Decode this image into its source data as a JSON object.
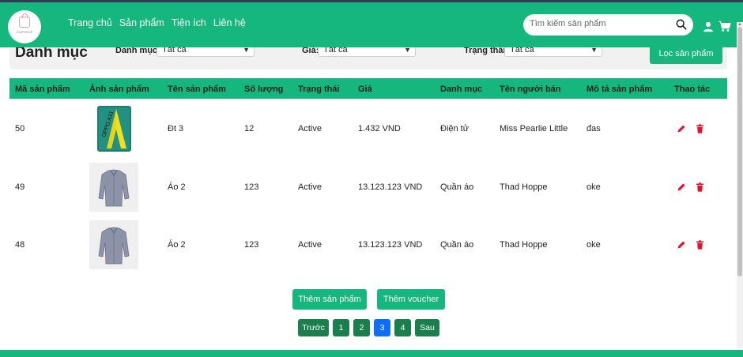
{
  "brand": {
    "logo_text": "CHIPSHOP"
  },
  "nav": {
    "links": [
      "Trang chủ",
      "Sản phẩm",
      "Tiện ích",
      "Liên hệ"
    ]
  },
  "search": {
    "placeholder": "Tìm kiếm sản phẩm",
    "value": ""
  },
  "filters": {
    "title": "Danh mục",
    "category_label": "Danh mục:",
    "category_value": "Tất cả",
    "price_label": "Giá:",
    "price_value": "Tất cả",
    "status_label": "Trạng thái:",
    "status_value": "Tất cả",
    "filter_button": "Lọc sản phẩm"
  },
  "table": {
    "headers": [
      "Mã sản phẩm",
      "Ảnh sản phẩm",
      "Tên sản phẩm",
      "Số lượng",
      "Trạng thái",
      "Giá",
      "Danh mục",
      "Tên người bán",
      "Mô tả sản phẩm",
      "Thao tác"
    ],
    "rows": [
      {
        "id": "50",
        "image": "phone",
        "name": "Đt 3",
        "quantity": "12",
        "status": "Active",
        "price": "1.432 VND",
        "category": "Điện tử",
        "seller": "Miss Pearlie Little",
        "description": "đas"
      },
      {
        "id": "49",
        "image": "shirt",
        "name": "Áo 2",
        "quantity": "123",
        "status": "Active",
        "price": "13.123.123 VND",
        "category": "Quần áo",
        "seller": "Thad Hoppe",
        "description": "oke"
      },
      {
        "id": "48",
        "image": "shirt",
        "name": "Áo 2",
        "quantity": "123",
        "status": "Active",
        "price": "13.123.123 VND",
        "category": "Quần áo",
        "seller": "Thad Hoppe",
        "description": "oke"
      }
    ]
  },
  "actions": {
    "add_product": "Thêm sản phẩm",
    "add_voucher": "Thêm voucher"
  },
  "pagination": {
    "prev": "Trước",
    "pages": [
      "1",
      "2",
      "3",
      "4"
    ],
    "current": "3",
    "next": "Sau"
  },
  "phone_image_text": "OPPO A31",
  "colors": {
    "primary": "#15b77e",
    "pager": "#1a7f4d",
    "pager_active": "#0d6efd",
    "action_red": "#e8112d"
  },
  "icons": {
    "search": "search-icon",
    "user": "user-icon",
    "cart": "cart-icon",
    "edit": "pencil-icon",
    "delete": "trash-icon"
  }
}
